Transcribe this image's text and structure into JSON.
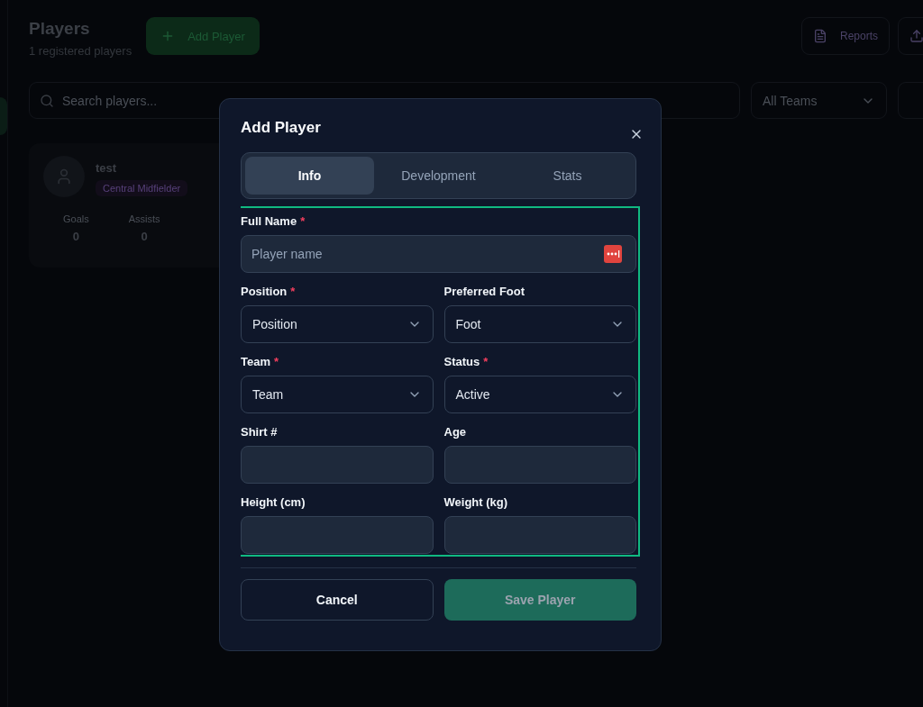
{
  "page": {
    "title": "Players",
    "subtitle": "1 registered players",
    "add_button": "Add Player",
    "reports_button": "Reports"
  },
  "filters": {
    "search_placeholder": "Search players...",
    "team_select": "All Teams"
  },
  "player_card": {
    "name": "test",
    "position": "Central Midfielder",
    "stats": [
      {
        "label": "Goals",
        "value": "0"
      },
      {
        "label": "Assists",
        "value": "0"
      }
    ]
  },
  "dialog": {
    "title": "Add Player",
    "required_mark": "*",
    "tabs": [
      {
        "label": "Info",
        "selected": true
      },
      {
        "label": "Development",
        "selected": false
      },
      {
        "label": "Stats",
        "selected": false
      }
    ],
    "full_name": {
      "label": "Full Name",
      "required": true,
      "placeholder": "Player name"
    },
    "fields": [
      {
        "label": "Position",
        "required": true,
        "kind": "select",
        "value": "Position"
      },
      {
        "label": "Preferred Foot",
        "required": false,
        "kind": "select",
        "value": "Foot"
      },
      {
        "label": "Team",
        "required": true,
        "kind": "select",
        "value": "Team"
      },
      {
        "label": "Status",
        "required": true,
        "kind": "select",
        "value": "Active"
      },
      {
        "label": "Shirt #",
        "required": false,
        "kind": "input"
      },
      {
        "label": "Age",
        "required": false,
        "kind": "input"
      },
      {
        "label": "Height (cm)",
        "required": false,
        "kind": "input"
      },
      {
        "label": "Weight (kg)",
        "required": false,
        "kind": "input"
      }
    ],
    "buttons": {
      "cancel": "Cancel",
      "save": "Save Player"
    }
  }
}
